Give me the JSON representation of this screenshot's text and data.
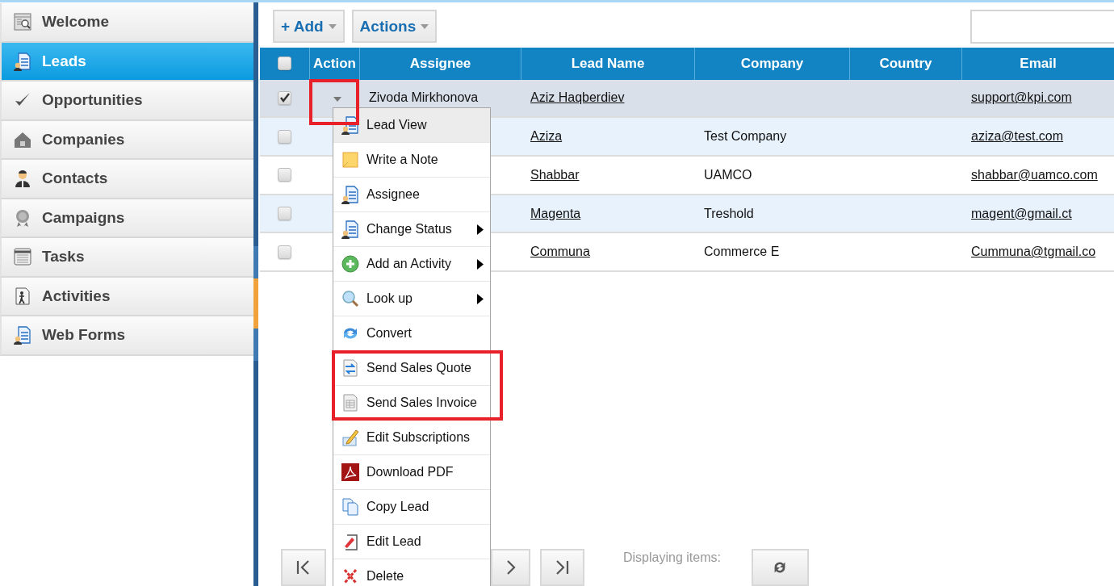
{
  "sidebar": {
    "items": [
      {
        "label": "Welcome",
        "selected": false
      },
      {
        "label": "Leads",
        "selected": true
      },
      {
        "label": "Opportunities",
        "selected": false
      },
      {
        "label": "Companies",
        "selected": false
      },
      {
        "label": "Contacts",
        "selected": false
      },
      {
        "label": "Campaigns",
        "selected": false
      },
      {
        "label": "Tasks",
        "selected": false
      },
      {
        "label": "Activities",
        "selected": false
      },
      {
        "label": "Web Forms",
        "selected": false
      }
    ]
  },
  "toolbar": {
    "buttons": [
      {
        "label": "+ Add"
      },
      {
        "label": "Actions"
      }
    ]
  },
  "table": {
    "select_all_checked": false,
    "columns": [
      "Action",
      "Assignee",
      "Lead Name",
      "Company",
      "Country",
      "Email"
    ],
    "rows": [
      {
        "checked": true,
        "selected": true,
        "caret": true,
        "assignee": "Zivoda Mirkhonova",
        "lead_name": "Aziz Haqberdiev",
        "email": "support@kpi.com"
      },
      {
        "checked": false,
        "selected": false,
        "lead_name": "Aziza",
        "company": "Test Company",
        "email": "aziza@test.com"
      },
      {
        "checked": false,
        "selected": false,
        "lead_name": "Shabbar",
        "company": "UAMCO",
        "email": "shabbar@uamco.com"
      },
      {
        "checked": false,
        "selected": false,
        "lead_name": "Magenta",
        "company": "Treshold",
        "email": "magent@gmail.ct"
      },
      {
        "checked": false,
        "selected": false,
        "lead_name": "Communa",
        "company": "Commerce E",
        "email": "Cummuna@tgmail.co"
      }
    ]
  },
  "context_menu": {
    "items": [
      {
        "label": "Lead View",
        "highlighted": true,
        "submenu": false
      },
      {
        "label": "Write a Note",
        "highlighted": false,
        "submenu": false
      },
      {
        "label": "Assignee",
        "highlighted": false,
        "submenu": false
      },
      {
        "label": "Change Status",
        "highlighted": false,
        "submenu": true
      },
      {
        "label": "Add an Activity",
        "highlighted": false,
        "submenu": true
      },
      {
        "label": "Look up",
        "highlighted": false,
        "submenu": true
      },
      {
        "label": "Convert",
        "highlighted": false,
        "submenu": false
      },
      {
        "label": "Send Sales Quote",
        "highlighted": false,
        "submenu": false
      },
      {
        "label": "Send Sales Invoice",
        "highlighted": false,
        "submenu": false
      },
      {
        "label": "Edit Subscriptions",
        "highlighted": false,
        "submenu": false
      },
      {
        "label": "Download PDF",
        "highlighted": false,
        "submenu": false
      },
      {
        "label": "Copy Lead",
        "highlighted": false,
        "submenu": false
      },
      {
        "label": "Edit Lead",
        "highlighted": false,
        "submenu": false
      },
      {
        "label": "Delete",
        "highlighted": false,
        "submenu": false
      }
    ]
  },
  "pager": {
    "status": "Displaying items:"
  }
}
